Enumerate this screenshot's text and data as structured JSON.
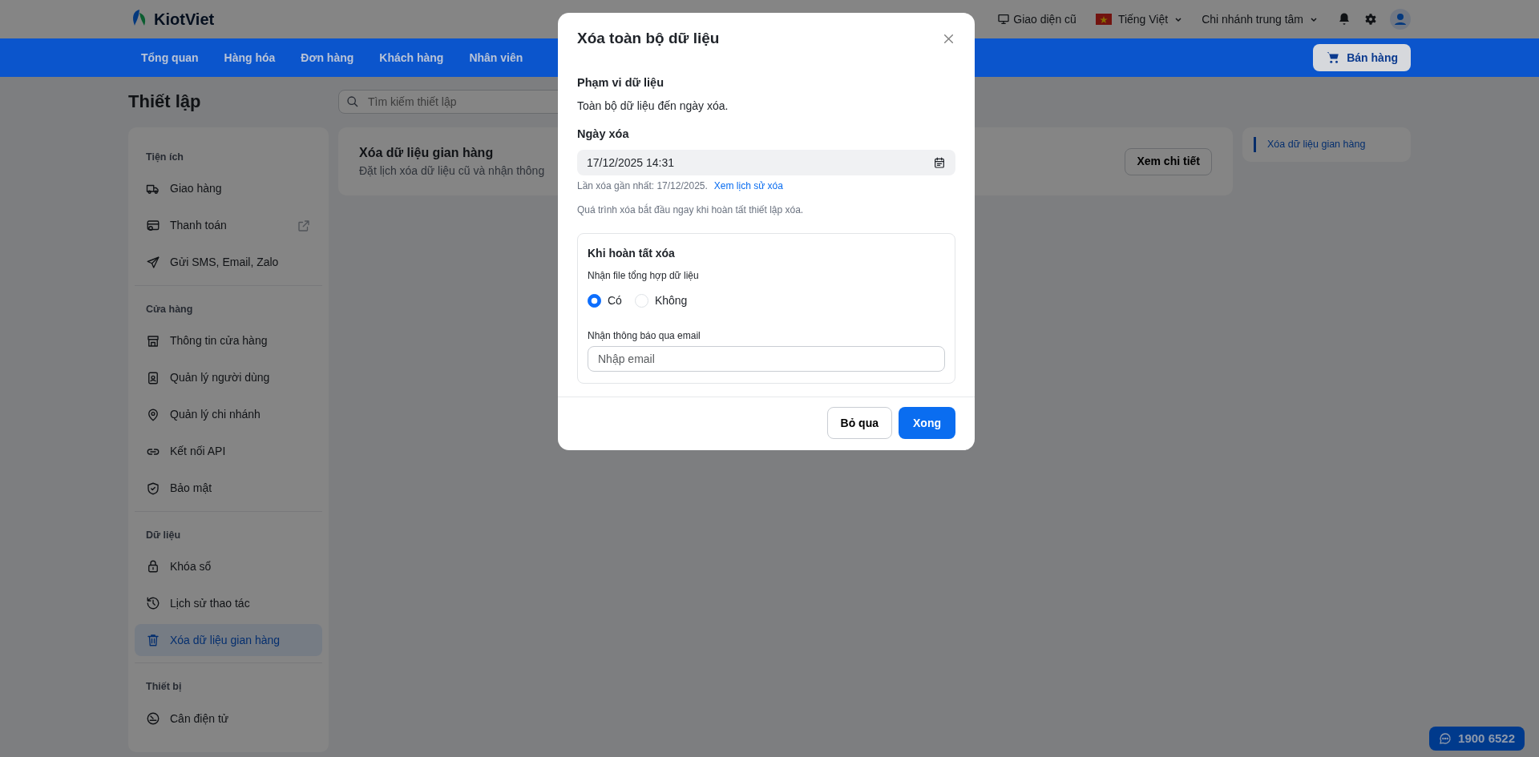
{
  "header": {
    "logo": "KiotViet",
    "legacy_link": "Giao diện cũ",
    "language": "Tiếng Việt",
    "branch": "Chi nhánh trung tâm"
  },
  "nav": {
    "items": [
      {
        "label": "Tổng quan",
        "selected": false
      },
      {
        "label": "Hàng hóa",
        "selected": false
      },
      {
        "label": "Đơn hàng",
        "selected": false
      },
      {
        "label": "Khách hàng",
        "selected": false
      },
      {
        "label": "Nhân viên",
        "selected": false
      }
    ],
    "sell_button": "Bán hàng"
  },
  "page_title": "Thiết lập",
  "search": {
    "placeholder": "Tìm kiếm thiết lập"
  },
  "sidebar": {
    "sections": [
      {
        "title": "Tiện ích",
        "items": [
          {
            "label": "Giao hàng",
            "selected": false,
            "external": false
          },
          {
            "label": "Thanh toán",
            "selected": false,
            "external": true
          },
          {
            "label": "Gửi SMS, Email, Zalo",
            "selected": false,
            "external": false
          }
        ]
      },
      {
        "title": "Cửa hàng",
        "items": [
          {
            "label": "Thông tin cửa hàng",
            "selected": false,
            "external": false
          },
          {
            "label": "Quản lý người dùng",
            "selected": false,
            "external": false
          },
          {
            "label": "Quản lý chi nhánh",
            "selected": false,
            "external": false
          },
          {
            "label": "Kết nối API",
            "selected": false,
            "external": false
          },
          {
            "label": "Bảo mật",
            "selected": false,
            "external": false
          }
        ]
      },
      {
        "title": "Dữ liệu",
        "items": [
          {
            "label": "Khóa sổ",
            "selected": false,
            "external": false
          },
          {
            "label": "Lịch sử thao tác",
            "selected": false,
            "external": false
          },
          {
            "label": "Xóa dữ liệu gian hàng",
            "selected": true,
            "external": false
          }
        ]
      },
      {
        "title": "Thiết bị",
        "items": [
          {
            "label": "Cân điện tử",
            "selected": false,
            "external": false
          }
        ]
      }
    ]
  },
  "main_card": {
    "title": "Xóa dữ liệu gian hàng",
    "description": "Đặt lịch xóa dữ liệu cũ và nhận thông",
    "button": "Xem chi tiết"
  },
  "toc": {
    "items": [
      {
        "label": "Xóa dữ liệu gian hàng",
        "selected": true
      }
    ]
  },
  "modal": {
    "title": "Xóa toàn bộ dữ liệu",
    "scope_label": "Phạm vi dữ liệu",
    "scope_text": "Toàn bộ dữ liệu đến ngày xóa.",
    "date_label": "Ngày xóa",
    "date_value": "17/12/2025 14:31",
    "last_deleted": "Lần xóa gần nhất: 17/12/2025.",
    "history_link": "Xem lịch sử xóa",
    "note": "Quá trình xóa bắt đầu ngay khi hoàn tất thiết lập xóa.",
    "completion": {
      "title": "Khi hoàn tất xóa",
      "file_label": "Nhận file tổng hợp dữ liệu",
      "options": [
        {
          "label": "Có",
          "selected": true
        },
        {
          "label": "Không",
          "selected": false
        }
      ],
      "email_label": "Nhận thông báo qua email",
      "email_placeholder": "Nhập email"
    },
    "cancel_button": "Bỏ qua",
    "confirm_button": "Xong"
  },
  "hotline": "1900 6522"
}
